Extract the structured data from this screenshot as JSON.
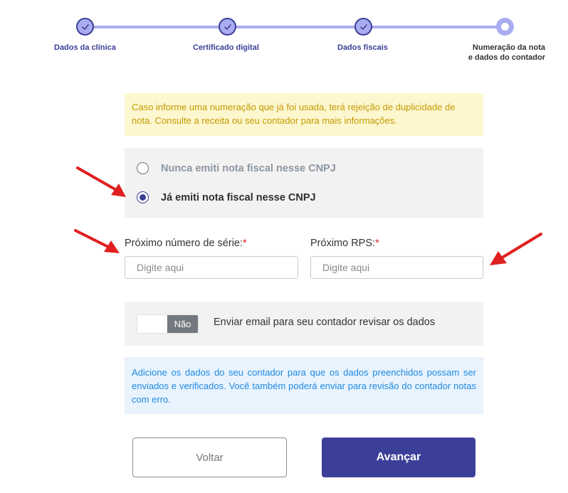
{
  "stepper": {
    "steps": [
      {
        "label": "Dados da clínica",
        "state": "done"
      },
      {
        "label": "Certificado digital",
        "state": "done"
      },
      {
        "label": "Dados fiscais",
        "state": "done"
      },
      {
        "label_line1": "Numeração da nota",
        "label_line2": "e dados do contador",
        "state": "current"
      }
    ]
  },
  "warning": {
    "text": "Caso informe uma numeração que já foi usada, terá rejeição de duplicidade de nota. Consulte a receita ou seu contador para mais informações."
  },
  "emission": {
    "options": [
      {
        "label": "Nunca emiti nota fiscal nesse CNPJ",
        "selected": false
      },
      {
        "label": "Já emiti nota fiscal nesse CNPJ",
        "selected": true
      }
    ]
  },
  "fields": {
    "serie": {
      "label": "Próximo número de série:",
      "required_mark": "*",
      "placeholder": "Digite aqui",
      "value": ""
    },
    "rps": {
      "label": "Próximo RPS:",
      "required_mark": "*",
      "placeholder": "Digite aqui",
      "value": ""
    }
  },
  "accountant_email": {
    "toggle_label": "Não",
    "enabled": false,
    "text": "Enviar email para seu contador revisar os dados"
  },
  "info": {
    "text": "Adicione os dados do seu contador para que os dados preenchidos possam ser enviados e verificados. Você também poderá enviar para revisão do contador notas com erro."
  },
  "actions": {
    "back_label": "Voltar",
    "next_label": "Avançar"
  },
  "colors": {
    "primary": "#3c3f98",
    "stepper_track": "#a9acf0",
    "warning_bg": "#fdf7cf",
    "warning_text": "#c39a00",
    "info_bg": "#e8f3fd",
    "info_text": "#2089e0",
    "annotation_arrow": "#e02020"
  }
}
